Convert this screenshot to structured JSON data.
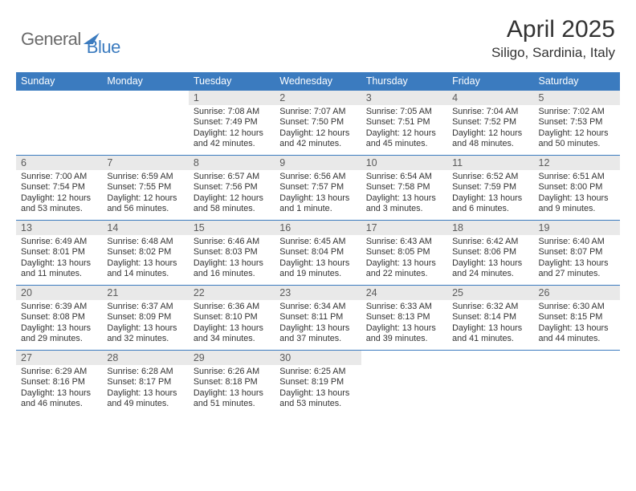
{
  "logo": {
    "part1": "General",
    "part2": "Blue"
  },
  "title": "April 2025",
  "location": "Siligo, Sardinia, Italy",
  "day_headers": [
    "Sunday",
    "Monday",
    "Tuesday",
    "Wednesday",
    "Thursday",
    "Friday",
    "Saturday"
  ],
  "weeks": [
    [
      null,
      null,
      {
        "n": "1",
        "sr": "Sunrise: 7:08 AM",
        "ss": "Sunset: 7:49 PM",
        "d1": "Daylight: 12 hours",
        "d2": "and 42 minutes."
      },
      {
        "n": "2",
        "sr": "Sunrise: 7:07 AM",
        "ss": "Sunset: 7:50 PM",
        "d1": "Daylight: 12 hours",
        "d2": "and 42 minutes."
      },
      {
        "n": "3",
        "sr": "Sunrise: 7:05 AM",
        "ss": "Sunset: 7:51 PM",
        "d1": "Daylight: 12 hours",
        "d2": "and 45 minutes."
      },
      {
        "n": "4",
        "sr": "Sunrise: 7:04 AM",
        "ss": "Sunset: 7:52 PM",
        "d1": "Daylight: 12 hours",
        "d2": "and 48 minutes."
      },
      {
        "n": "5",
        "sr": "Sunrise: 7:02 AM",
        "ss": "Sunset: 7:53 PM",
        "d1": "Daylight: 12 hours",
        "d2": "and 50 minutes."
      }
    ],
    [
      {
        "n": "6",
        "sr": "Sunrise: 7:00 AM",
        "ss": "Sunset: 7:54 PM",
        "d1": "Daylight: 12 hours",
        "d2": "and 53 minutes."
      },
      {
        "n": "7",
        "sr": "Sunrise: 6:59 AM",
        "ss": "Sunset: 7:55 PM",
        "d1": "Daylight: 12 hours",
        "d2": "and 56 minutes."
      },
      {
        "n": "8",
        "sr": "Sunrise: 6:57 AM",
        "ss": "Sunset: 7:56 PM",
        "d1": "Daylight: 12 hours",
        "d2": "and 58 minutes."
      },
      {
        "n": "9",
        "sr": "Sunrise: 6:56 AM",
        "ss": "Sunset: 7:57 PM",
        "d1": "Daylight: 13 hours",
        "d2": "and 1 minute."
      },
      {
        "n": "10",
        "sr": "Sunrise: 6:54 AM",
        "ss": "Sunset: 7:58 PM",
        "d1": "Daylight: 13 hours",
        "d2": "and 3 minutes."
      },
      {
        "n": "11",
        "sr": "Sunrise: 6:52 AM",
        "ss": "Sunset: 7:59 PM",
        "d1": "Daylight: 13 hours",
        "d2": "and 6 minutes."
      },
      {
        "n": "12",
        "sr": "Sunrise: 6:51 AM",
        "ss": "Sunset: 8:00 PM",
        "d1": "Daylight: 13 hours",
        "d2": "and 9 minutes."
      }
    ],
    [
      {
        "n": "13",
        "sr": "Sunrise: 6:49 AM",
        "ss": "Sunset: 8:01 PM",
        "d1": "Daylight: 13 hours",
        "d2": "and 11 minutes."
      },
      {
        "n": "14",
        "sr": "Sunrise: 6:48 AM",
        "ss": "Sunset: 8:02 PM",
        "d1": "Daylight: 13 hours",
        "d2": "and 14 minutes."
      },
      {
        "n": "15",
        "sr": "Sunrise: 6:46 AM",
        "ss": "Sunset: 8:03 PM",
        "d1": "Daylight: 13 hours",
        "d2": "and 16 minutes."
      },
      {
        "n": "16",
        "sr": "Sunrise: 6:45 AM",
        "ss": "Sunset: 8:04 PM",
        "d1": "Daylight: 13 hours",
        "d2": "and 19 minutes."
      },
      {
        "n": "17",
        "sr": "Sunrise: 6:43 AM",
        "ss": "Sunset: 8:05 PM",
        "d1": "Daylight: 13 hours",
        "d2": "and 22 minutes."
      },
      {
        "n": "18",
        "sr": "Sunrise: 6:42 AM",
        "ss": "Sunset: 8:06 PM",
        "d1": "Daylight: 13 hours",
        "d2": "and 24 minutes."
      },
      {
        "n": "19",
        "sr": "Sunrise: 6:40 AM",
        "ss": "Sunset: 8:07 PM",
        "d1": "Daylight: 13 hours",
        "d2": "and 27 minutes."
      }
    ],
    [
      {
        "n": "20",
        "sr": "Sunrise: 6:39 AM",
        "ss": "Sunset: 8:08 PM",
        "d1": "Daylight: 13 hours",
        "d2": "and 29 minutes."
      },
      {
        "n": "21",
        "sr": "Sunrise: 6:37 AM",
        "ss": "Sunset: 8:09 PM",
        "d1": "Daylight: 13 hours",
        "d2": "and 32 minutes."
      },
      {
        "n": "22",
        "sr": "Sunrise: 6:36 AM",
        "ss": "Sunset: 8:10 PM",
        "d1": "Daylight: 13 hours",
        "d2": "and 34 minutes."
      },
      {
        "n": "23",
        "sr": "Sunrise: 6:34 AM",
        "ss": "Sunset: 8:11 PM",
        "d1": "Daylight: 13 hours",
        "d2": "and 37 minutes."
      },
      {
        "n": "24",
        "sr": "Sunrise: 6:33 AM",
        "ss": "Sunset: 8:13 PM",
        "d1": "Daylight: 13 hours",
        "d2": "and 39 minutes."
      },
      {
        "n": "25",
        "sr": "Sunrise: 6:32 AM",
        "ss": "Sunset: 8:14 PM",
        "d1": "Daylight: 13 hours",
        "d2": "and 41 minutes."
      },
      {
        "n": "26",
        "sr": "Sunrise: 6:30 AM",
        "ss": "Sunset: 8:15 PM",
        "d1": "Daylight: 13 hours",
        "d2": "and 44 minutes."
      }
    ],
    [
      {
        "n": "27",
        "sr": "Sunrise: 6:29 AM",
        "ss": "Sunset: 8:16 PM",
        "d1": "Daylight: 13 hours",
        "d2": "and 46 minutes."
      },
      {
        "n": "28",
        "sr": "Sunrise: 6:28 AM",
        "ss": "Sunset: 8:17 PM",
        "d1": "Daylight: 13 hours",
        "d2": "and 49 minutes."
      },
      {
        "n": "29",
        "sr": "Sunrise: 6:26 AM",
        "ss": "Sunset: 8:18 PM",
        "d1": "Daylight: 13 hours",
        "d2": "and 51 minutes."
      },
      {
        "n": "30",
        "sr": "Sunrise: 6:25 AM",
        "ss": "Sunset: 8:19 PM",
        "d1": "Daylight: 13 hours",
        "d2": "and 53 minutes."
      },
      null,
      null,
      null
    ]
  ]
}
